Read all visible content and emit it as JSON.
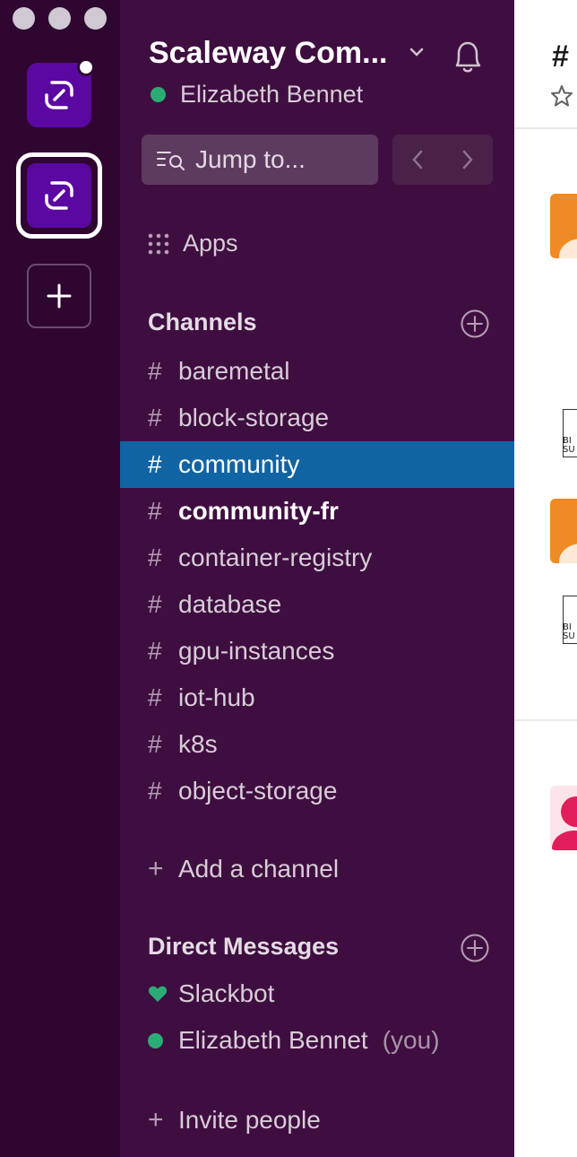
{
  "workspace": {
    "name": "Scaleway Com...",
    "user": "Elizabeth Bennet"
  },
  "search": {
    "placeholder": "Jump to..."
  },
  "apps_label": "Apps",
  "channels": {
    "title": "Channels",
    "items": [
      {
        "name": "baremetal",
        "state": "normal"
      },
      {
        "name": "block-storage",
        "state": "normal"
      },
      {
        "name": "community",
        "state": "active"
      },
      {
        "name": "community-fr",
        "state": "unread"
      },
      {
        "name": "container-registry",
        "state": "normal"
      },
      {
        "name": "database",
        "state": "normal"
      },
      {
        "name": "gpu-instances",
        "state": "normal"
      },
      {
        "name": "iot-hub",
        "state": "normal"
      },
      {
        "name": "k8s",
        "state": "normal"
      },
      {
        "name": "object-storage",
        "state": "normal"
      }
    ],
    "add_label": "Add a channel"
  },
  "direct_messages": {
    "title": "Direct Messages",
    "items": [
      {
        "name": "Slackbot",
        "icon": "heart-icon"
      },
      {
        "name": "Elizabeth Bennet",
        "suffix": "(you)",
        "icon": "presence-dot-icon"
      }
    ]
  },
  "invite_label": "Invite people",
  "main": {
    "title": "#",
    "thumb_text_1": "BI\nSU",
    "thumb_text_2": "BI\nSU"
  },
  "colors": {
    "rail": "#2e0630",
    "sidebar": "#3f0e40",
    "active": "#1164a3",
    "presence": "#2bac76",
    "workspace_icon": "#5b07a1"
  }
}
